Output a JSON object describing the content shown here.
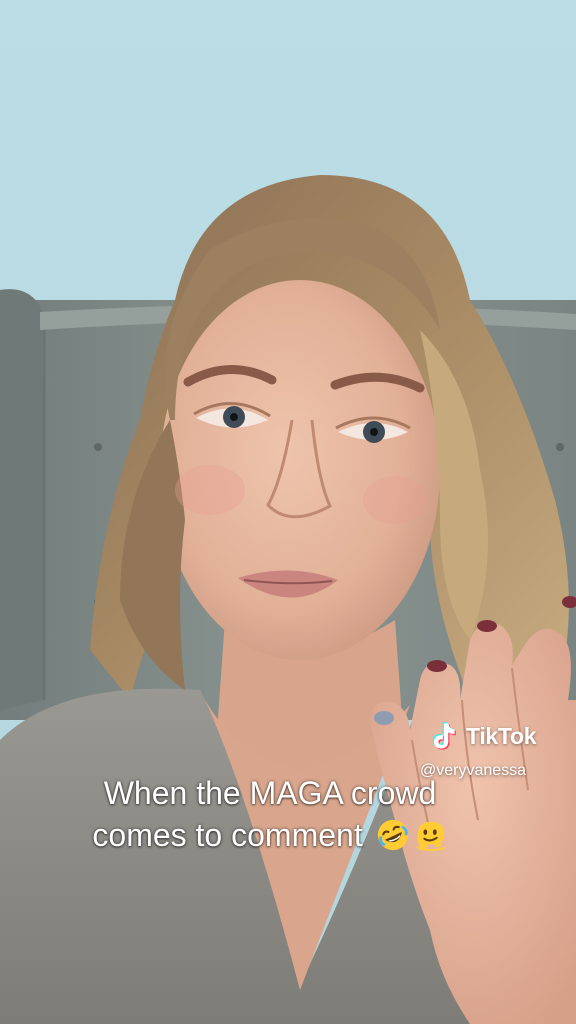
{
  "video": {
    "caption_line_1": "When the MAGA crowd",
    "caption_line_2": "comes to comment",
    "caption_emojis": [
      "rolling-on-floor-laughing-emoji",
      "melting-face-emoji"
    ]
  },
  "watermark": {
    "brand": "TikTok",
    "handle": "@veryvanessa",
    "logo_icon": "tiktok-logo-icon"
  },
  "colors": {
    "wall": "#b9dbe3",
    "sofa": "#7f8a87",
    "sweater": "#8d8b85",
    "skin": "#e2b49c",
    "hair": "#9b7f5e",
    "tiktok_cyan": "#25f4ee",
    "tiktok_red": "#fe2c55"
  }
}
